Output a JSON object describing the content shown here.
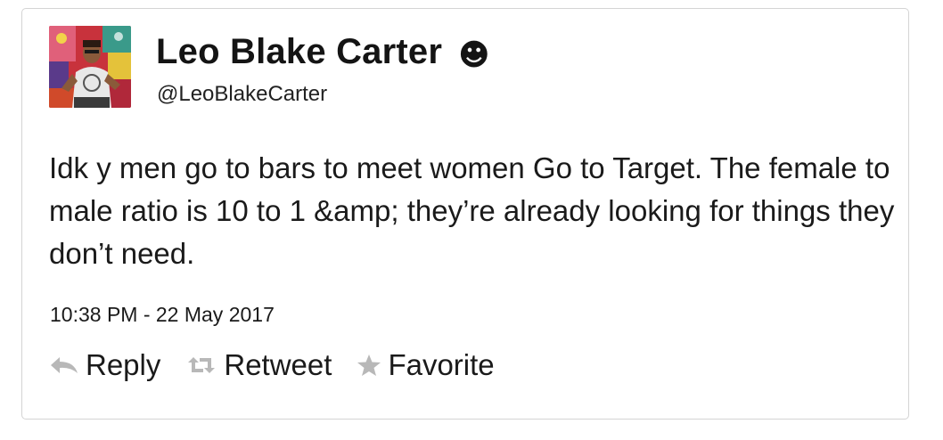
{
  "tweet": {
    "display_name": "Leo Blake Carter",
    "name_emoji": "☻",
    "handle": "@LeoBlakeCarter",
    "text": "Idk y men go to bars to meet women Go to Target. The female to male ratio is 10 to 1 &amp; they’re already looking for things they don’t need.",
    "timestamp": "10:38 PM - 22 May 2017"
  },
  "actions": {
    "reply_label": "Reply",
    "retweet_label": "Retweet",
    "favorite_label": "Favorite"
  },
  "icons": {
    "reply": "reply-icon",
    "retweet": "retweet-icon",
    "favorite": "star-icon"
  },
  "colors": {
    "text": "#1a1a1a",
    "icon_gray": "#b8b8b8",
    "border": "#d4d4d4"
  }
}
